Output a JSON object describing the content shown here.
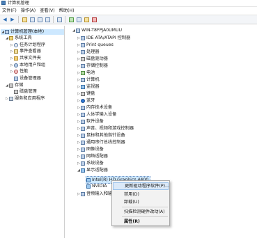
{
  "window": {
    "title": "计算机管理"
  },
  "menu": {
    "items": [
      "文件(F)",
      "操作(A)",
      "查看(V)",
      "帮助(H)"
    ]
  },
  "left_tree": {
    "root": "计算机管理(本地)",
    "system_tools": "系统工具",
    "task_scheduler": "任务计划程序",
    "event_viewer": "事件查看器",
    "shared_folders": "共享文件夹",
    "local_users": "本地用户和组",
    "performance": "性能",
    "device_manager": "设备管理器",
    "storage": "存储",
    "disk_management": "磁盘管理",
    "services_apps": "服务和应用程序"
  },
  "device_tree": {
    "computer": "WIN-T8FPJA0UMUU",
    "categories": [
      "IDE ATA/ATAPI 控制器",
      "Print queues",
      "处理器",
      "磁盘驱动器",
      "存储控制器",
      "电池",
      "计算机",
      "监视器",
      "键盘",
      "蓝牙",
      "内存技术设备",
      "人体学输入设备",
      "软件设备",
      "声音、视频和游戏控制器",
      "鼠标和其他指针设备",
      "通用串行总线控制器",
      "图像设备",
      "网络适配器",
      "系统设备",
      "显示适配器"
    ],
    "display_children": [
      "Intel(R) HD Graphics 4400",
      "NVIDIA"
    ],
    "after": "音频输入和输出"
  },
  "context_menu": {
    "items": [
      "更新驱动程序软件(P)...",
      "禁用(D)",
      "卸载(U)",
      "扫描检测硬件改动(A)",
      "属性(R)"
    ]
  }
}
